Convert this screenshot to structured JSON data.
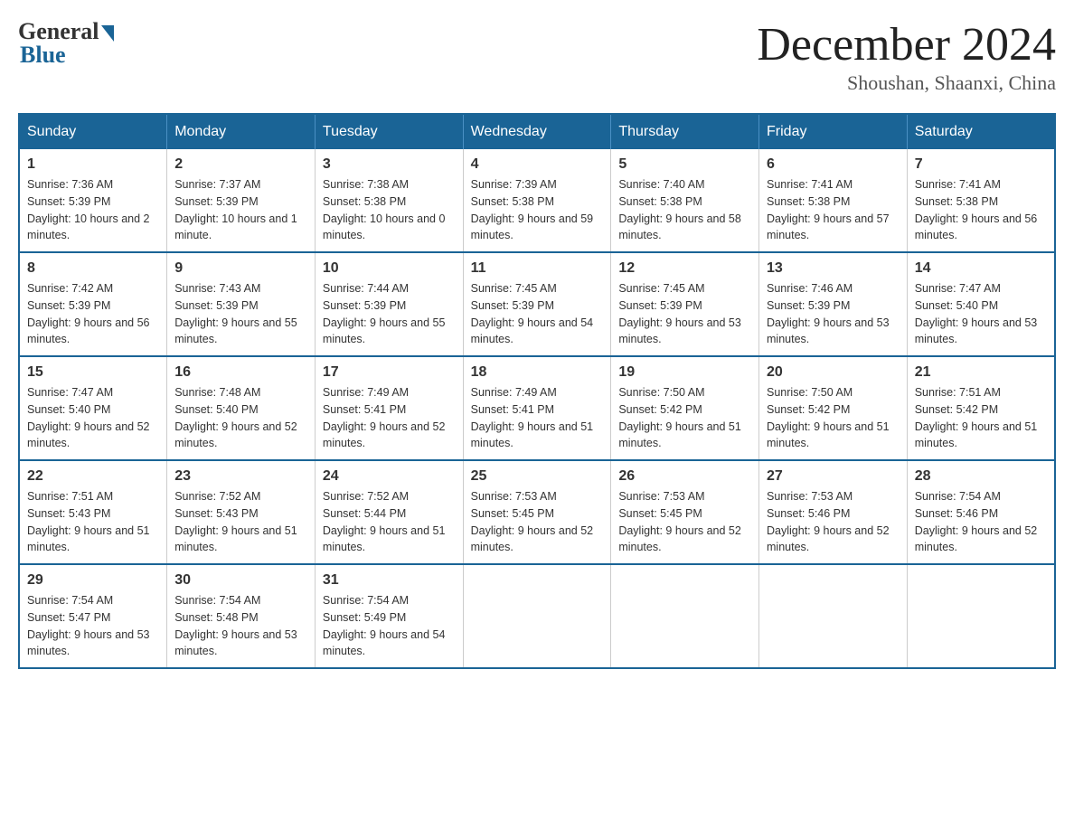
{
  "header": {
    "logo_general": "General",
    "logo_blue": "Blue",
    "month_title": "December 2024",
    "location": "Shoushan, Shaanxi, China"
  },
  "weekdays": [
    "Sunday",
    "Monday",
    "Tuesday",
    "Wednesday",
    "Thursday",
    "Friday",
    "Saturday"
  ],
  "weeks": [
    [
      {
        "day": "1",
        "sunrise": "7:36 AM",
        "sunset": "5:39 PM",
        "daylight": "10 hours and 2 minutes."
      },
      {
        "day": "2",
        "sunrise": "7:37 AM",
        "sunset": "5:39 PM",
        "daylight": "10 hours and 1 minute."
      },
      {
        "day": "3",
        "sunrise": "7:38 AM",
        "sunset": "5:38 PM",
        "daylight": "10 hours and 0 minutes."
      },
      {
        "day": "4",
        "sunrise": "7:39 AM",
        "sunset": "5:38 PM",
        "daylight": "9 hours and 59 minutes."
      },
      {
        "day": "5",
        "sunrise": "7:40 AM",
        "sunset": "5:38 PM",
        "daylight": "9 hours and 58 minutes."
      },
      {
        "day": "6",
        "sunrise": "7:41 AM",
        "sunset": "5:38 PM",
        "daylight": "9 hours and 57 minutes."
      },
      {
        "day": "7",
        "sunrise": "7:41 AM",
        "sunset": "5:38 PM",
        "daylight": "9 hours and 56 minutes."
      }
    ],
    [
      {
        "day": "8",
        "sunrise": "7:42 AM",
        "sunset": "5:39 PM",
        "daylight": "9 hours and 56 minutes."
      },
      {
        "day": "9",
        "sunrise": "7:43 AM",
        "sunset": "5:39 PM",
        "daylight": "9 hours and 55 minutes."
      },
      {
        "day": "10",
        "sunrise": "7:44 AM",
        "sunset": "5:39 PM",
        "daylight": "9 hours and 55 minutes."
      },
      {
        "day": "11",
        "sunrise": "7:45 AM",
        "sunset": "5:39 PM",
        "daylight": "9 hours and 54 minutes."
      },
      {
        "day": "12",
        "sunrise": "7:45 AM",
        "sunset": "5:39 PM",
        "daylight": "9 hours and 53 minutes."
      },
      {
        "day": "13",
        "sunrise": "7:46 AM",
        "sunset": "5:39 PM",
        "daylight": "9 hours and 53 minutes."
      },
      {
        "day": "14",
        "sunrise": "7:47 AM",
        "sunset": "5:40 PM",
        "daylight": "9 hours and 53 minutes."
      }
    ],
    [
      {
        "day": "15",
        "sunrise": "7:47 AM",
        "sunset": "5:40 PM",
        "daylight": "9 hours and 52 minutes."
      },
      {
        "day": "16",
        "sunrise": "7:48 AM",
        "sunset": "5:40 PM",
        "daylight": "9 hours and 52 minutes."
      },
      {
        "day": "17",
        "sunrise": "7:49 AM",
        "sunset": "5:41 PM",
        "daylight": "9 hours and 52 minutes."
      },
      {
        "day": "18",
        "sunrise": "7:49 AM",
        "sunset": "5:41 PM",
        "daylight": "9 hours and 51 minutes."
      },
      {
        "day": "19",
        "sunrise": "7:50 AM",
        "sunset": "5:42 PM",
        "daylight": "9 hours and 51 minutes."
      },
      {
        "day": "20",
        "sunrise": "7:50 AM",
        "sunset": "5:42 PM",
        "daylight": "9 hours and 51 minutes."
      },
      {
        "day": "21",
        "sunrise": "7:51 AM",
        "sunset": "5:42 PM",
        "daylight": "9 hours and 51 minutes."
      }
    ],
    [
      {
        "day": "22",
        "sunrise": "7:51 AM",
        "sunset": "5:43 PM",
        "daylight": "9 hours and 51 minutes."
      },
      {
        "day": "23",
        "sunrise": "7:52 AM",
        "sunset": "5:43 PM",
        "daylight": "9 hours and 51 minutes."
      },
      {
        "day": "24",
        "sunrise": "7:52 AM",
        "sunset": "5:44 PM",
        "daylight": "9 hours and 51 minutes."
      },
      {
        "day": "25",
        "sunrise": "7:53 AM",
        "sunset": "5:45 PM",
        "daylight": "9 hours and 52 minutes."
      },
      {
        "day": "26",
        "sunrise": "7:53 AM",
        "sunset": "5:45 PM",
        "daylight": "9 hours and 52 minutes."
      },
      {
        "day": "27",
        "sunrise": "7:53 AM",
        "sunset": "5:46 PM",
        "daylight": "9 hours and 52 minutes."
      },
      {
        "day": "28",
        "sunrise": "7:54 AM",
        "sunset": "5:46 PM",
        "daylight": "9 hours and 52 minutes."
      }
    ],
    [
      {
        "day": "29",
        "sunrise": "7:54 AM",
        "sunset": "5:47 PM",
        "daylight": "9 hours and 53 minutes."
      },
      {
        "day": "30",
        "sunrise": "7:54 AM",
        "sunset": "5:48 PM",
        "daylight": "9 hours and 53 minutes."
      },
      {
        "day": "31",
        "sunrise": "7:54 AM",
        "sunset": "5:49 PM",
        "daylight": "9 hours and 54 minutes."
      },
      null,
      null,
      null,
      null
    ]
  ]
}
